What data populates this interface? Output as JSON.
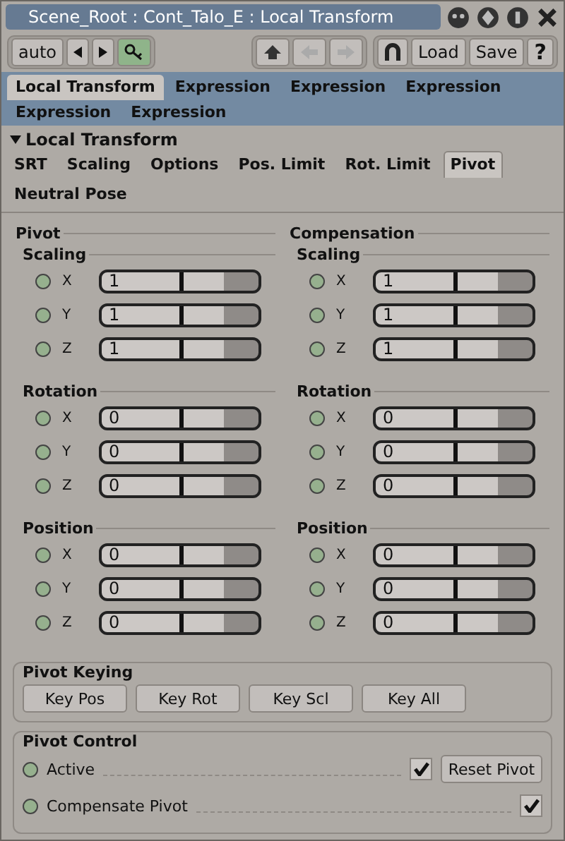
{
  "window": {
    "title": "Scene_Root : Cont_Talo_E : Local Transform"
  },
  "toolbar": {
    "mode": "auto",
    "load": "Load",
    "save": "Save",
    "help": "?"
  },
  "tabs": [
    {
      "label": "Local Transform",
      "selected": true
    },
    {
      "label": "Expression",
      "selected": false
    },
    {
      "label": "Expression",
      "selected": false
    },
    {
      "label": "Expression",
      "selected": false
    },
    {
      "label": "Expression",
      "selected": false
    },
    {
      "label": "Expression",
      "selected": false
    }
  ],
  "section": {
    "title": "Local Transform",
    "expanded": true
  },
  "subtabs": [
    {
      "label": "SRT",
      "selected": false
    },
    {
      "label": "Scaling",
      "selected": false
    },
    {
      "label": "Options",
      "selected": false
    },
    {
      "label": "Pos. Limit",
      "selected": false
    },
    {
      "label": "Rot. Limit",
      "selected": false
    },
    {
      "label": "Pivot",
      "selected": true
    },
    {
      "label": "Neutral Pose",
      "selected": false
    }
  ],
  "columns": [
    {
      "title": "Pivot",
      "groups": [
        {
          "title": "Scaling",
          "params": [
            {
              "axis": "X",
              "value": "1",
              "level": 0.5
            },
            {
              "axis": "Y",
              "value": "1",
              "level": 0.5
            },
            {
              "axis": "Z",
              "value": "1",
              "level": 0.5
            }
          ]
        },
        {
          "title": "Rotation",
          "params": [
            {
              "axis": "X",
              "value": "0",
              "level": 0.5
            },
            {
              "axis": "Y",
              "value": "0",
              "level": 0.5
            },
            {
              "axis": "Z",
              "value": "0",
              "level": 0.5
            }
          ]
        },
        {
          "title": "Position",
          "params": [
            {
              "axis": "X",
              "value": "0",
              "level": 0.5
            },
            {
              "axis": "Y",
              "value": "0",
              "level": 0.5
            },
            {
              "axis": "Z",
              "value": "0",
              "level": 0.5
            }
          ]
        }
      ]
    },
    {
      "title": "Compensation",
      "groups": [
        {
          "title": "Scaling",
          "params": [
            {
              "axis": "X",
              "value": "1",
              "level": 0.5
            },
            {
              "axis": "Y",
              "value": "1",
              "level": 0.5
            },
            {
              "axis": "Z",
              "value": "1",
              "level": 0.5
            }
          ]
        },
        {
          "title": "Rotation",
          "params": [
            {
              "axis": "X",
              "value": "0",
              "level": 0.5
            },
            {
              "axis": "Y",
              "value": "0",
              "level": 0.5
            },
            {
              "axis": "Z",
              "value": "0",
              "level": 0.5
            }
          ]
        },
        {
          "title": "Position",
          "params": [
            {
              "axis": "X",
              "value": "0",
              "level": 0.5
            },
            {
              "axis": "Y",
              "value": "0",
              "level": 0.5
            },
            {
              "axis": "Z",
              "value": "0",
              "level": 0.5
            }
          ]
        }
      ]
    }
  ],
  "keying": {
    "title": "Pivot Keying",
    "buttons": [
      "Key Pos",
      "Key Rot",
      "Key Scl",
      "Key All"
    ]
  },
  "control": {
    "title": "Pivot Control",
    "rows": [
      {
        "label": "Active",
        "checked": true,
        "button": "Reset Pivot"
      },
      {
        "label": "Compensate Pivot",
        "checked": true
      }
    ]
  }
}
